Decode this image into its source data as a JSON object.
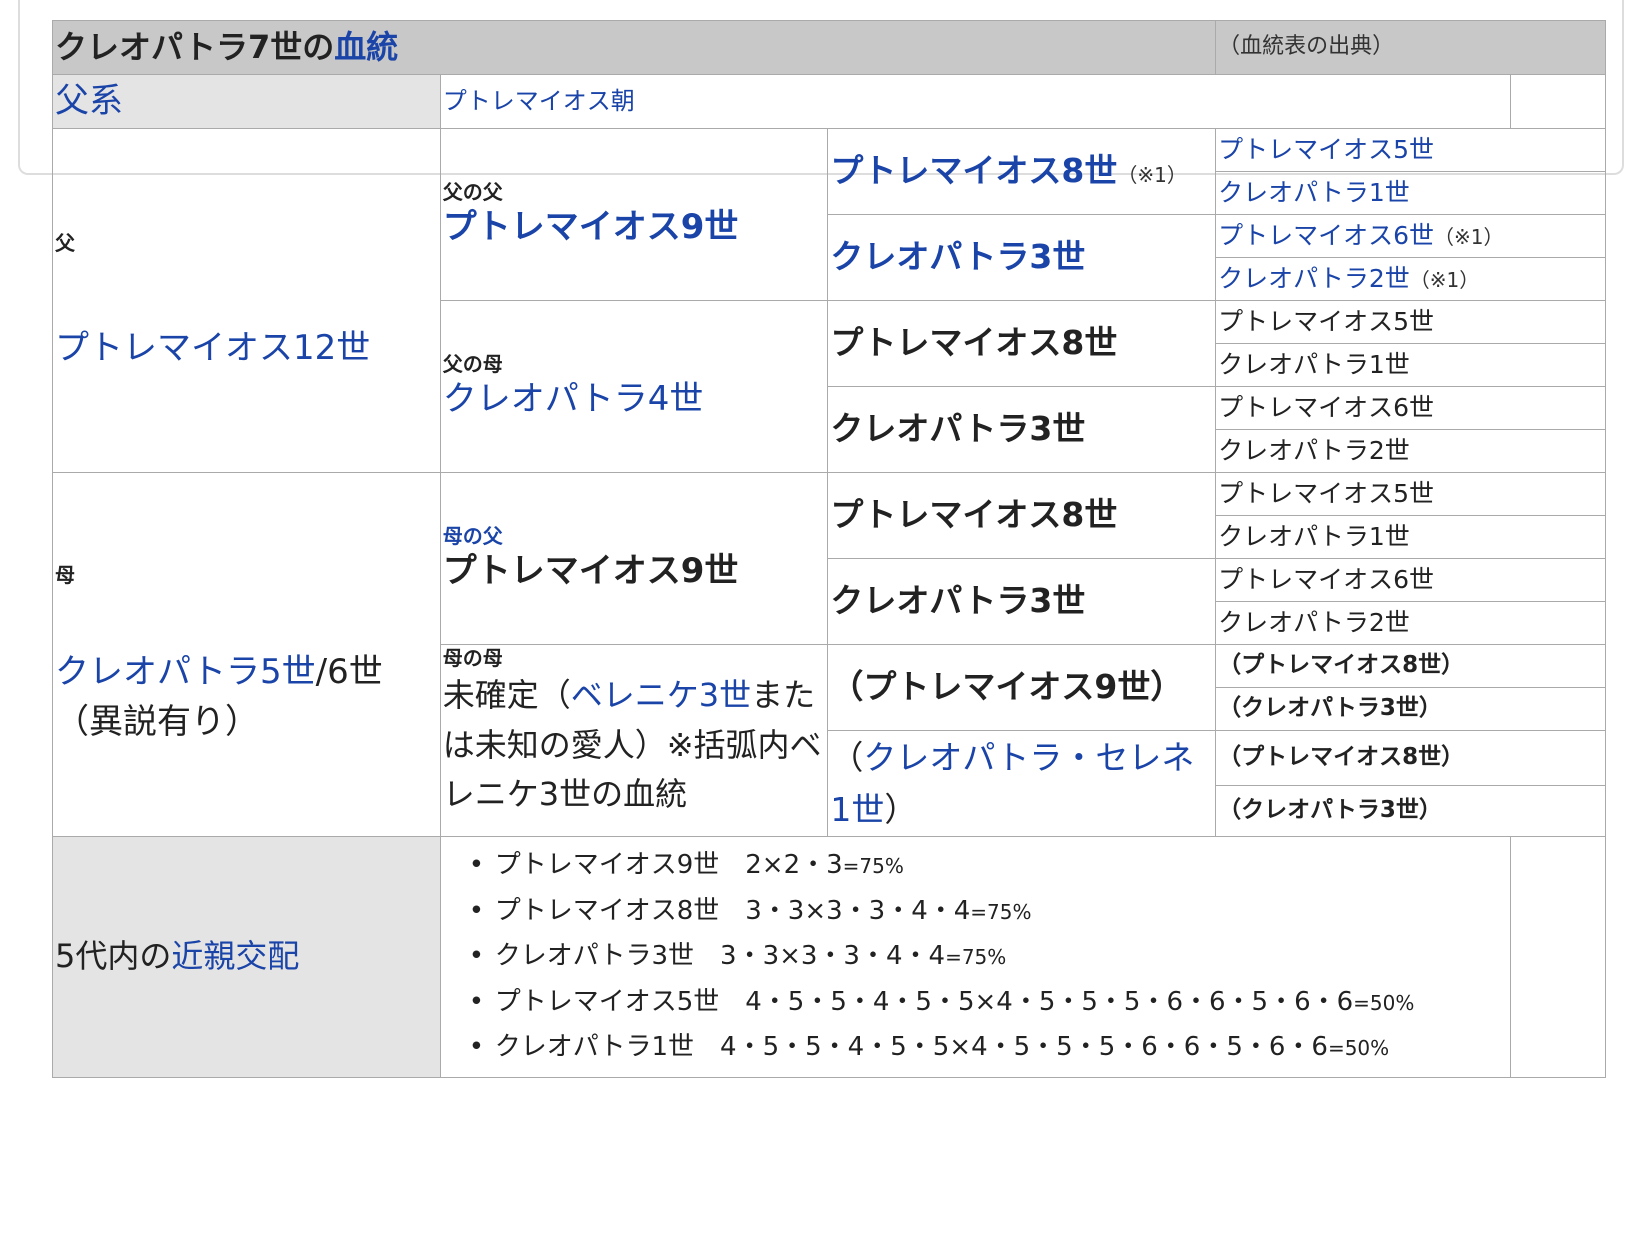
{
  "header": {
    "title_part1": "クレオパトラ7世の",
    "title_link": "血統",
    "source_note": "（血統表の出典）"
  },
  "patriline": {
    "label": "父系",
    "value": "プトレマイオス朝"
  },
  "father": {
    "label": "父",
    "name": "プトレマイオス12世"
  },
  "mother": {
    "label": "母",
    "name_link": "クレオパトラ5世",
    "name_suffix": "/6世",
    "note": "（異説有り）"
  },
  "ff": {
    "label": "父の父",
    "name": "プトレマイオス9世",
    "g3a": {
      "name": "プトレマイオス8世",
      "note": "（※1）"
    },
    "g3b": {
      "name": "クレオパトラ3世"
    },
    "g4": [
      {
        "name": "プトレマイオス5世",
        "note": ""
      },
      {
        "name": "クレオパトラ1世",
        "note": ""
      },
      {
        "name": "プトレマイオス6世",
        "note": "（※1）"
      },
      {
        "name": "クレオパトラ2世",
        "note": "（※1）"
      }
    ]
  },
  "fm": {
    "label": "父の母",
    "name": "クレオパトラ4世",
    "g3a": "プトレマイオス8世",
    "g3b": "クレオパトラ3世",
    "g4": [
      "プトレマイオス5世",
      "クレオパトラ1世",
      "プトレマイオス6世",
      "クレオパトラ2世"
    ]
  },
  "mf": {
    "label": "母の父",
    "name": "プトレマイオス9世",
    "g3a": "プトレマイオス8世",
    "g3b": "クレオパトラ3世",
    "g4": [
      "プトレマイオス5世",
      "クレオパトラ1世",
      "プトレマイオス6世",
      "クレオパトラ2世"
    ]
  },
  "mm": {
    "label": "母の母",
    "text_before": "未確定（",
    "link": "ベレニケ3世",
    "text_after": "または未知の愛人）※括弧内ベレニケ3世の血統",
    "g3a": "（プトレマイオス9世）",
    "g3b_open": "（",
    "g3b_link": "クレオパトラ・セレネ1世",
    "g3b_close": "）",
    "g4": [
      "（プトレマイオス8世）",
      "（クレオパトラ3世）",
      "（プトレマイオス8世）",
      "（クレオパトラ3世）"
    ]
  },
  "inbreeding": {
    "label_prefix": "5代内の",
    "label_link": "近親交配",
    "items": [
      {
        "text": "プトレマイオス9世　2×2・3",
        "pct": "=75%"
      },
      {
        "text": "プトレマイオス8世　3・3×3・3・4・4",
        "pct": "=75%"
      },
      {
        "text": "クレオパトラ3世　3・3×3・3・4・4",
        "pct": "=75%"
      },
      {
        "text": "プトレマイオス5世　4・5・5・4・5・5×4・5・5・5・6・6・5・6・6",
        "pct": "=50%"
      },
      {
        "text": "クレオパトラ1世　4・5・5・4・5・5×4・5・5・5・6・6・5・6・6",
        "pct": "=50%"
      }
    ]
  }
}
